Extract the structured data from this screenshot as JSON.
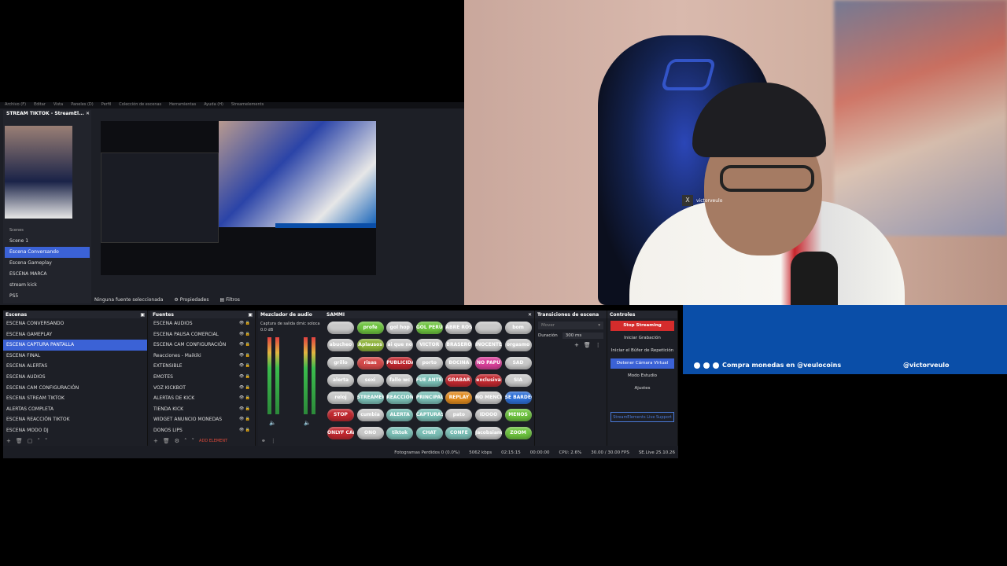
{
  "menu": [
    "Archivo (F)",
    "Editar",
    "Vista",
    "Paneles (D)",
    "Perfil",
    "Colección de escenas",
    "Herramientas",
    "Ayuda (H)",
    "Streamelements"
  ],
  "tiktok_dock": {
    "title": "STREAM TIKTOK - StreamEl...",
    "scenes_label": "Scenes",
    "scenes": [
      "Scene 1",
      "Escena Conversando",
      "Escena Gameplay",
      "ESCENA MARCA",
      "stream kick",
      "PS5"
    ],
    "active_index": 1
  },
  "canvas_status": {
    "selection": "Ninguna fuente seleccionada",
    "properties": "Propiedades",
    "filters": "Filtros"
  },
  "webcam": {
    "tag_x": "X",
    "tag_name": "victorveulo"
  },
  "overlay": {
    "left_text": "Compra monedas en @veulocoins",
    "right_text": "@victorveulo"
  },
  "scenes_panel": {
    "title": "Escenas",
    "items": [
      "ESCENA CONVERSANDO",
      "ESCENA GAMEPLAY",
      "ESCENA CAPTURA PANTALLA",
      "ESCENA FINAL",
      "ESCENA ALERTAS",
      "ESCENA AUDIOS",
      "ESCENA CAM CONFIGURACIÓN",
      "ESCENA STREAM TIKTOK",
      "ALERTAS COMPLETA",
      "ESCENA REACCIÓN TIKTOK",
      "ESCENA MODO DJ"
    ],
    "selected_index": 2
  },
  "sources_panel": {
    "title": "Fuentes",
    "items": [
      "ESCENA AUDIOS",
      "ESCENA PAUSA COMERCIAL",
      "ESCENA CAM CONFIGURACIÓN",
      "Reacciones - Maikiki",
      "EXTENSIBLE",
      "EMOTES",
      "VOZ KICKBOT",
      "ALERTAS DE KICK",
      "TIENDA KICK",
      "WIDGET ANUNCIO MONEDAS",
      "DONOS LIPS"
    ],
    "add_label": "ADD ELEMENT"
  },
  "mixer_panel": {
    "title": "Mezclador de audio",
    "ch1": "Captura de salida d",
    "ch2": "mic soloca",
    "db": "0.0 dB"
  },
  "sammi_panel": {
    "title": "SAMMI",
    "buttons": [
      {
        "label": "",
        "color": "#c9c9c9"
      },
      {
        "label": "profe",
        "color": "#6dc33f"
      },
      {
        "label": "gol hop",
        "color": "#c9c9c9"
      },
      {
        "label": "GOL PERU",
        "color": "#6dc33f"
      },
      {
        "label": "ABRE ROSA",
        "color": "#c9c9c9"
      },
      {
        "label": "",
        "color": "#c9c9c9"
      },
      {
        "label": "bom",
        "color": "#c9c9c9"
      },
      {
        "label": "abucheo",
        "color": "#c9c9c9"
      },
      {
        "label": "Aplausos",
        "color": "#8db23a"
      },
      {
        "label": "ai que no",
        "color": "#c9c9c9"
      },
      {
        "label": "VICTOR",
        "color": "#c9c9c9"
      },
      {
        "label": "BRASERO",
        "color": "#c9c9c9"
      },
      {
        "label": "INOCENTE",
        "color": "#c9c9c9"
      },
      {
        "label": "orgasmo",
        "color": "#c9c9c9"
      },
      {
        "label": "grillo",
        "color": "#c9c9c9"
      },
      {
        "label": "risas",
        "color": "#d44a4a"
      },
      {
        "label": "PUBLICIDAD",
        "color": "#c0282f"
      },
      {
        "label": "porto",
        "color": "#c9c9c9"
      },
      {
        "label": "BOCINA",
        "color": "#c9c9c9"
      },
      {
        "label": "NO PAPU",
        "color": "#d9409a"
      },
      {
        "label": "SAD",
        "color": "#c9c9c9"
      },
      {
        "label": "alerta",
        "color": "#c9c9c9"
      },
      {
        "label": "sexi",
        "color": "#c9c9c9"
      },
      {
        "label": "fallo wc",
        "color": "#c9c9c9"
      },
      {
        "label": "FUE ANTES",
        "color": "#7bbfb6"
      },
      {
        "label": "GRABAR",
        "color": "#c0282f"
      },
      {
        "label": "exclusiva",
        "color": "#c0282f"
      },
      {
        "label": "SIA",
        "color": "#c9c9c9"
      },
      {
        "label": "reloj",
        "color": "#c9c9c9"
      },
      {
        "label": "STREAMER",
        "color": "#7bbfb6"
      },
      {
        "label": "REACCIONES",
        "color": "#7bbfb6"
      },
      {
        "label": "PRINCIPAL",
        "color": "#7bbfb6"
      },
      {
        "label": "REPLAY",
        "color": "#e08a1e"
      },
      {
        "label": "NO MENCIONES",
        "color": "#c9c9c9"
      },
      {
        "label": "SE BARDEO",
        "color": "#2d6fd6"
      },
      {
        "label": "STOP",
        "color": "#c0282f"
      },
      {
        "label": "cumbia",
        "color": "#c9c9c9"
      },
      {
        "label": "ALERTA",
        "color": "#7bbfb6"
      },
      {
        "label": "CAPTURAS",
        "color": "#7bbfb6"
      },
      {
        "label": "pato",
        "color": "#c9c9c9"
      },
      {
        "label": "IDOOO",
        "color": "#c9c9c9"
      },
      {
        "label": "MENOS",
        "color": "#6dc33f"
      },
      {
        "label": "ONLYF CAM",
        "color": "#c0282f"
      },
      {
        "label": "ONO",
        "color": "#c9c9c9"
      },
      {
        "label": "tiktok",
        "color": "#7bbfb6"
      },
      {
        "label": "CHAT",
        "color": "#7bbfb6"
      },
      {
        "label": "CONFE",
        "color": "#7bbfb6"
      },
      {
        "label": "Jacobsiano",
        "color": "#c9c9c9"
      },
      {
        "label": "ZOOM",
        "color": "#6dc33f"
      }
    ]
  },
  "transitions_panel": {
    "title": "Transiciones de escena",
    "type": "Mover",
    "duration_label": "Duración",
    "duration_value": "300 ms"
  },
  "controls_panel": {
    "title": "Controles",
    "buttons": [
      "Stop Streaming",
      "Iniciar Grabación",
      "Iniciar el Búfer de Repetición",
      "Detener Cámara Virtual",
      "Modo Estudio",
      "Ajustes"
    ],
    "se_support": "StreamElements Live Support"
  },
  "statusbar": {
    "dropped": "Fotogramas Perdidos 0 (0.0%)",
    "bitrate": "5062 kbps",
    "live_time": "02:15:15",
    "rec_time": "00:00:00",
    "cpu": "CPU: 2.6%",
    "fps": "30.00 / 30.00 FPS",
    "se": "SE.Live 25.10.26"
  }
}
